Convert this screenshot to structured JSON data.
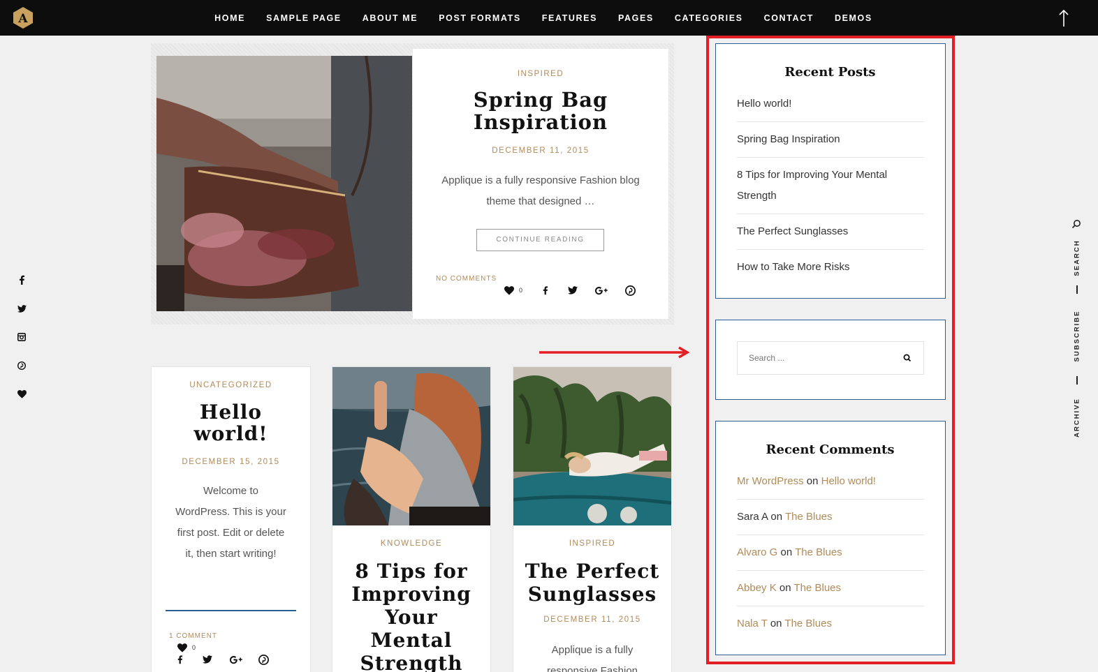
{
  "nav": {
    "items": [
      "HOME",
      "SAMPLE PAGE",
      "ABOUT ME",
      "POST FORMATS",
      "FEATURES",
      "PAGES",
      "CATEGORIES",
      "CONTACT",
      "DEMOS"
    ],
    "logo_letter": "A"
  },
  "left_social": [
    "facebook-icon",
    "twitter-icon",
    "instagram-icon",
    "pinterest-icon",
    "heart-icon"
  ],
  "right_rail": {
    "search": "SEARCH",
    "subscribe": "SUBSCRIBE",
    "archive": "ARCHIVE"
  },
  "featured": {
    "category": "INSPIRED",
    "title_line1": "Spring Bag",
    "title_line2": "Inspiration",
    "date": "DECEMBER 11, 2015",
    "excerpt_line1": "Applique is a fully responsive Fashion blog",
    "excerpt_line2": "theme that designed …",
    "button": "CONTINUE READING",
    "comments": "NO COMMENTS",
    "likes": "0"
  },
  "cards": [
    {
      "category": "UNCATEGORIZED",
      "title_line1": "Hello",
      "title_line2": "world!",
      "date": "DECEMBER 15, 2015",
      "excerpt": [
        "Welcome to",
        "WordPress. This is your",
        "first post. Edit or delete",
        "it, then start writing!"
      ],
      "comments": "1 COMMENT",
      "likes": "0"
    },
    {
      "category": "KNOWLEDGE",
      "title_lines": [
        "8 Tips for",
        "Improving",
        "Your",
        "Mental",
        "Strength"
      ]
    },
    {
      "category": "INSPIRED",
      "title_line1": "The Perfect",
      "title_line2": "Sunglasses",
      "date": "DECEMBER 11, 2015",
      "excerpt": [
        "Applique is a fully",
        "responsive Fashion"
      ]
    }
  ],
  "sidebar": {
    "recent_posts": {
      "title": "Recent Posts",
      "items": [
        "Hello world!",
        "Spring Bag Inspiration",
        "8 Tips for Improving Your Mental Strength",
        "The Perfect Sunglasses",
        "How to Take More Risks"
      ]
    },
    "search": {
      "placeholder": "Search ..."
    },
    "recent_comments": {
      "title": "Recent Comments",
      "items": [
        {
          "author": "Mr WordPress",
          "on": "on",
          "post": "Hello world!"
        },
        {
          "author": "Sara A",
          "on": "on",
          "post": "The Blues"
        },
        {
          "author": "Alvaro G",
          "on": "on",
          "post": "The Blues"
        },
        {
          "author": "Abbey K",
          "on": "on",
          "post": "The Blues"
        },
        {
          "author": "Nala T",
          "on": "on",
          "post": "The Blues"
        }
      ]
    }
  },
  "colors": {
    "accent": "#b08a59",
    "highlight": "#e31e24",
    "widget_border": "#2b5f94",
    "nav_bg": "#0d0d0d"
  }
}
